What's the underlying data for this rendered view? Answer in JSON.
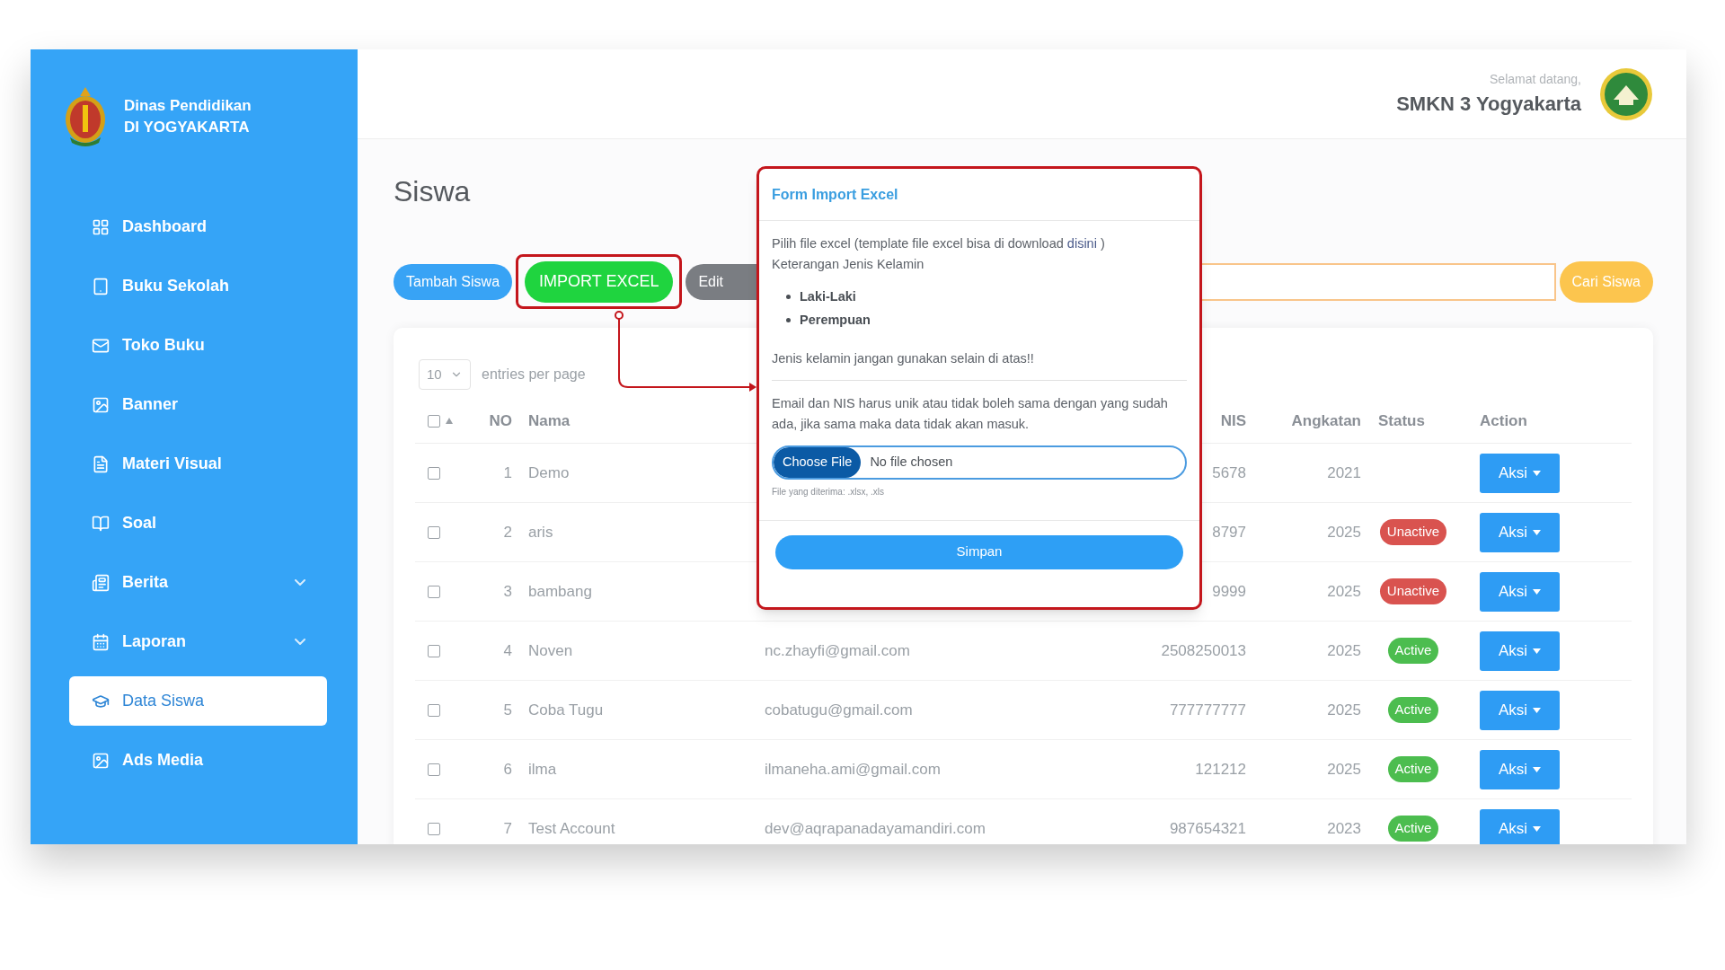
{
  "sidebar": {
    "brand": {
      "line1": "Dinas Pendidikan",
      "line2": "DI YOGYAKARTA"
    },
    "items": [
      {
        "label": "Dashboard",
        "kind": "link",
        "selected": false
      },
      {
        "label": "Buku Sekolah",
        "kind": "link",
        "selected": false
      },
      {
        "label": "Toko Buku",
        "kind": "link",
        "selected": false
      },
      {
        "label": "Banner",
        "kind": "link",
        "selected": false
      },
      {
        "label": "Materi Visual",
        "kind": "link",
        "selected": false
      },
      {
        "label": "Soal",
        "kind": "link",
        "selected": false
      },
      {
        "label": "Berita",
        "kind": "dropdown",
        "selected": false
      },
      {
        "label": "Laporan",
        "kind": "dropdown",
        "selected": false
      },
      {
        "label": "Data Siswa",
        "kind": "link",
        "selected": true
      },
      {
        "label": "Ads Media",
        "kind": "link",
        "selected": false
      }
    ]
  },
  "header": {
    "greeting": "Selamat datang,",
    "school": "SMKN 3 Yogyakarta"
  },
  "page": {
    "title": "Siswa"
  },
  "toolbar": {
    "buttons": [
      {
        "label": "Tambah Siswa",
        "kind": "primary",
        "highlighted": false
      },
      {
        "label": "IMPORT EXCEL",
        "kind": "success",
        "highlighted": true
      },
      {
        "label": "Edit",
        "kind": "secondary",
        "highlighted": false
      }
    ],
    "search_button": "Cari Siswa"
  },
  "table": {
    "select_all_checked": false,
    "page_size": "10",
    "page_size_label": "entries per page",
    "columns": {
      "no": "NO",
      "name": "Nama",
      "nis": "NIS",
      "year": "Angkatan",
      "status": "Status",
      "action": "Action"
    },
    "rows": [
      {
        "checked": false,
        "no": "1",
        "name": "Demo",
        "nis": "5678",
        "year": "2021",
        "action": "Aksi"
      },
      {
        "checked": false,
        "no": "2",
        "name": "aris",
        "nis": "8797",
        "year": "2025",
        "status": {
          "label": "Unactive",
          "kind": "inactive"
        },
        "action": "Aksi"
      },
      {
        "checked": false,
        "no": "3",
        "name": "bambang",
        "nis": "9999",
        "year": "2025",
        "status": {
          "label": "Unactive",
          "kind": "inactive"
        },
        "action": "Aksi"
      },
      {
        "checked": false,
        "no": "4",
        "name": "Noven",
        "email": "nc.zhayfi@gmail.com",
        "nis": "2508250013",
        "year": "2025",
        "status": {
          "label": "Active",
          "kind": "active"
        },
        "action": "Aksi"
      },
      {
        "checked": false,
        "no": "5",
        "name": "Coba Tugu",
        "email": "cobatugu@gmail.com",
        "nis": "777777777",
        "year": "2025",
        "status": {
          "label": "Active",
          "kind": "active"
        },
        "action": "Aksi"
      },
      {
        "checked": false,
        "no": "6",
        "name": "ilma",
        "email": "ilmaneha.ami@gmail.com",
        "nis": "121212",
        "year": "2025",
        "status": {
          "label": "Active",
          "kind": "active"
        },
        "action": "Aksi"
      },
      {
        "checked": false,
        "no": "7",
        "name": "Test Account",
        "email": "dev@aqrapanadayamandiri.com",
        "nis": "987654321",
        "year": "2023",
        "status": {
          "label": "Active",
          "kind": "active"
        },
        "action": "Aksi"
      }
    ]
  },
  "modal": {
    "title": "Form Import Excel",
    "intro_before": "Pilih file excel (template file excel bisa di download ",
    "link": "disini",
    "intro_after": " )",
    "legend_title": "Keterangan Jenis Kelamin",
    "options": [
      "Laki-Laki",
      "Perempuan"
    ],
    "warning": "Jenis kelamin jangan gunakan selain di atas!!",
    "note": "Email dan NIS harus unik atau tidak boleh sama dengan yang sudah ada, jika sama maka data tidak akan masuk.",
    "file_input": {
      "button": "Choose File",
      "status": "No file chosen",
      "hint": "File yang diterima: .xlsx, .xls"
    },
    "submit": "Simpan"
  }
}
